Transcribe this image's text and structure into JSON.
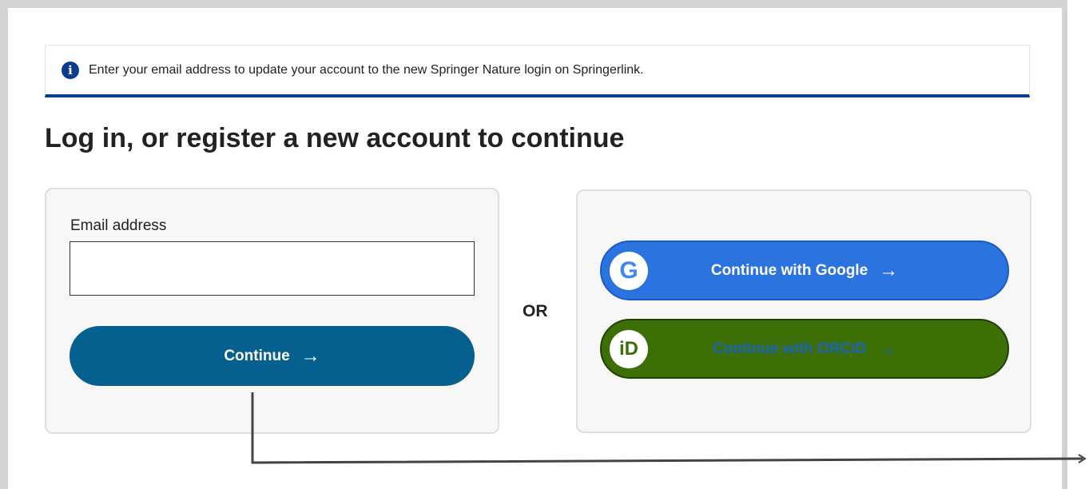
{
  "notice": {
    "text": "Enter your email address to update your account to the new Springer Nature login on Springerlink.",
    "icon": "info-icon"
  },
  "title": "Log in, or register a new account to continue",
  "login_form": {
    "email_label": "Email address",
    "email_value": "",
    "continue_label": "Continue"
  },
  "or_label": "OR",
  "social": {
    "google_label": "Continue with Google",
    "orcid_label": "Continue with ORCiD"
  },
  "colors": {
    "primary": "#05608f",
    "notice_accent": "#0a3d8f",
    "google": "#2b74df",
    "orcid": "#3c6f05"
  }
}
